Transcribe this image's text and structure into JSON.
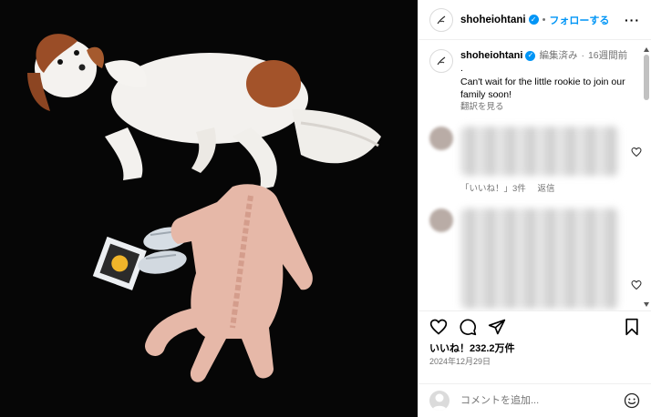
{
  "post": {
    "username": "shoheiohtani",
    "follow_label": "フォローする",
    "more_icon": "more-options-icon",
    "image_description": "dog lying on black floor with baby romper, sneakers and framed photo"
  },
  "caption": {
    "username": "shoheiohtani",
    "edited": "編集済み",
    "time_ago": "16週間前",
    "dot_line": ".",
    "text": "Can't wait for the little rookie to join our family soon!",
    "translate_label": "翻訳を見る"
  },
  "comment_actions": {
    "likes_label": "「いいね！」3件",
    "reply_label": "返信"
  },
  "stats": {
    "likes": "いいね！232.2万件",
    "date": "2024年12月29日"
  },
  "composer": {
    "placeholder": "コメントを追加..."
  },
  "colors": {
    "accent": "#0095f6",
    "secondary_text": "#737373",
    "border": "#efefef"
  }
}
